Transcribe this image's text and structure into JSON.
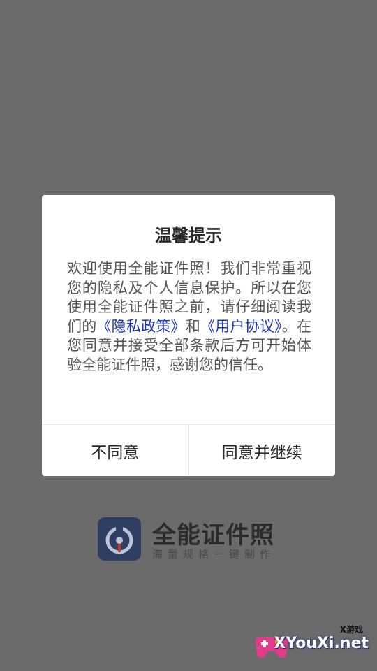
{
  "dialog": {
    "title": "温馨提示",
    "body": {
      "text_before_privacy": "欢迎使用全能证件照！我们非常重视您的隐私及个人信息保护。所以在您使用全能证件照之前，请仔细阅读我们的",
      "privacy_link": "《隐私政策》",
      "text_and": "和",
      "terms_link": "《用户协议》",
      "text_after_terms": "。在您同意并接受全部条款后方可开始体验全能证件照，感谢您的信任。"
    },
    "disagree_label": "不同意",
    "agree_label": "同意并继续"
  },
  "splash": {
    "app_name": "全能证件照",
    "slogan": "海量规格一键制作",
    "logo_icon": "camera-shutter-icon"
  },
  "watermark": {
    "label_small": "X游戏",
    "label_big": "XYouXi.net",
    "icon": "gamepad-icon"
  },
  "colors": {
    "overlay": "#6b6b6b",
    "link": "#1a35b8",
    "logo_bg": "#2f3e63",
    "logo_accent": "#c0392b"
  }
}
